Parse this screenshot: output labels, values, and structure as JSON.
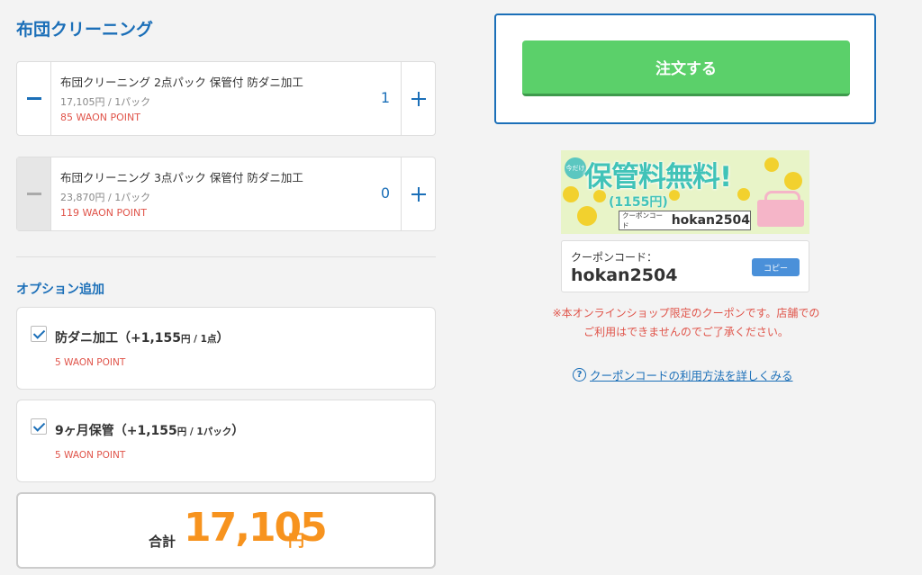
{
  "section_title": "布団クリーニング",
  "products": [
    {
      "name": "布団クリーニング 2点パック 保管付 防ダニ加工",
      "price": "17,105円 / 1パック",
      "points": "85 WAON POINT",
      "quantity": "1"
    },
    {
      "name": "布団クリーニング 3点パック 保管付 防ダニ加工",
      "price": "23,870円 / 1パック",
      "points": "119 WAON POINT",
      "quantity": "0"
    }
  ],
  "options_title": "オプション追加",
  "options": [
    {
      "label": "防ダニ加工（+1,155",
      "unit": "円 / 1点",
      "close": "）",
      "points": "5 WAON POINT",
      "checked": true
    },
    {
      "label": "9ヶ月保管（+1,155",
      "unit": "円 / 1パック",
      "close": "）",
      "points": "5 WAON POINT",
      "checked": true
    }
  ],
  "total": {
    "label": "合計",
    "value": "17,105",
    "unit": "円"
  },
  "order_button": "注文する",
  "banner": {
    "badge": "今だけ",
    "headline": "保管料無料!",
    "price": "(1155円)",
    "code_label": "クーポンコード",
    "code": "hokan2504"
  },
  "coupon": {
    "label": "クーポンコード：",
    "code": "hokan2504",
    "copy_label": "コピー"
  },
  "notice": "※本オンラインショップ限定のクーポンです。店舗でのご利用はできませんのでご了承ください。",
  "help_link": {
    "icon": "?",
    "text": "クーポンコードの利用方法を詳しくみる"
  },
  "colors": {
    "brand_blue": "#1b6fb8",
    "order_green": "#5bd06a",
    "total_orange": "#f7931e",
    "point_red": "#e0544a"
  }
}
